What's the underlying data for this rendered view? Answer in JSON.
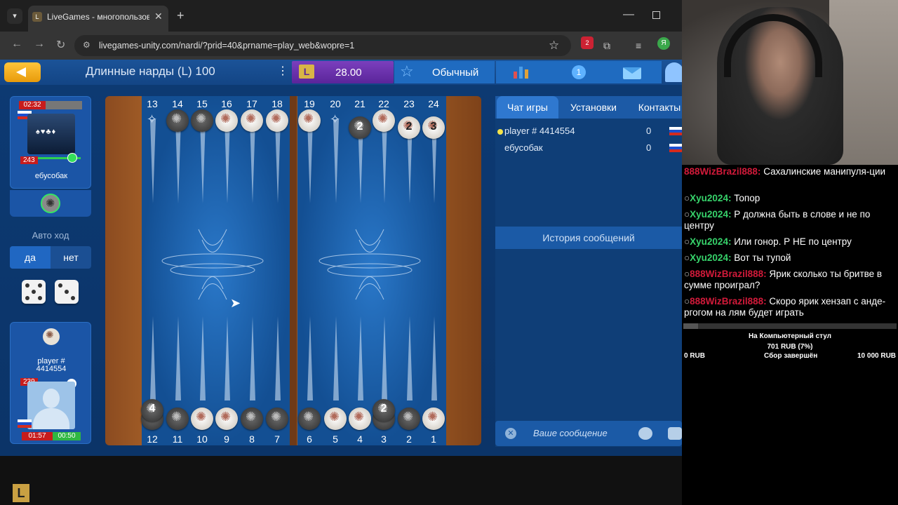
{
  "browser": {
    "tab_title": "LiveGames - многопользовате",
    "tab_favicon": "L",
    "url": "livegames-unity.com/nardi/?prid=40&prname=play_web&wopre=1",
    "ext_badge": "2",
    "profile_letter": "Я"
  },
  "topbar": {
    "title": "Длинные нарды (L) 100",
    "balance_icon": "L",
    "balance": "28.00",
    "mode": "Обычный",
    "info_count": "1"
  },
  "players": {
    "opponent": {
      "timer": "02:32",
      "rating": "243",
      "name": "ебусобак"
    },
    "auto_move_label": "Авто ход",
    "auto_yes": "да",
    "auto_no": "нет",
    "me": {
      "name": "player #\n4414554",
      "rating": "239",
      "time_total": "01:57",
      "time_move": "00:50"
    }
  },
  "dice": [
    5,
    3
  ],
  "board": {
    "top_numbers": [
      "13",
      "14",
      "15",
      "16",
      "17",
      "18",
      "19",
      "20",
      "21",
      "22",
      "23",
      "24"
    ],
    "bottom_numbers": [
      "12",
      "11",
      "10",
      "9",
      "8",
      "7",
      "6",
      "5",
      "4",
      "3",
      "2",
      "1"
    ],
    "top_checkers": [
      {
        "point": "13",
        "color": "empty",
        "count": ""
      },
      {
        "point": "14",
        "color": "b",
        "count": ""
      },
      {
        "point": "15",
        "color": "b",
        "count": ""
      },
      {
        "point": "16",
        "color": "w",
        "count": ""
      },
      {
        "point": "17",
        "color": "w",
        "count": ""
      },
      {
        "point": "18",
        "color": "w",
        "count": ""
      },
      {
        "point": "19",
        "color": "w",
        "count": ""
      },
      {
        "point": "20",
        "color": "empty",
        "count": ""
      },
      {
        "point": "21",
        "color": "b",
        "count": "2"
      },
      {
        "point": "22",
        "color": "w",
        "count": ""
      },
      {
        "point": "23",
        "color": "w",
        "count": "2"
      },
      {
        "point": "24",
        "color": "w",
        "count": "3"
      }
    ],
    "bottom_checkers": [
      {
        "point": "12",
        "color": "b",
        "count": "4"
      },
      {
        "point": "11",
        "color": "b",
        "count": ""
      },
      {
        "point": "10",
        "color": "w",
        "count": ""
      },
      {
        "point": "9",
        "color": "w",
        "count": ""
      },
      {
        "point": "8",
        "color": "b",
        "count": ""
      },
      {
        "point": "7",
        "color": "b",
        "count": ""
      },
      {
        "point": "6",
        "color": "b",
        "count": ""
      },
      {
        "point": "5",
        "color": "w",
        "count": ""
      },
      {
        "point": "4",
        "color": "w",
        "count": ""
      },
      {
        "point": "3",
        "color": "b",
        "count": "2"
      },
      {
        "point": "2",
        "color": "b",
        "count": ""
      },
      {
        "point": "1",
        "color": "w",
        "count": ""
      }
    ]
  },
  "chat": {
    "tab_chat": "Чат игры",
    "tab_settings": "Установки",
    "tab_contacts": "Контакты",
    "players": [
      {
        "name": "player # 4414554",
        "score": "0"
      },
      {
        "name": "ебусобак",
        "score": "0"
      }
    ],
    "history": "История сообщений",
    "placeholder": "Ваше сообщение"
  },
  "stream_chat": [
    {
      "user": "888WizBrazil888:",
      "text": "Сахалинские манипуля-ции",
      "red": true
    },
    {
      "user": "Xyu2024:",
      "text": "Топор",
      "red": false
    },
    {
      "user": "Xyu2024:",
      "text": "Р должна быть в слове и не по центру",
      "red": false
    },
    {
      "user": "Xyu2024:",
      "text": "Или гонор. Р НЕ по центру",
      "red": false
    },
    {
      "user": "Xyu2024:",
      "text": "Вот ты тупой",
      "red": false
    },
    {
      "user": "888WizBrazil888:",
      "text": "Ярик сколько ты бритве в сумме проиграл?",
      "red": true
    },
    {
      "user": "888WizBrazil888:",
      "text": "Скоро ярик хензап с анде-ргогом на лям будет играть",
      "red": true
    }
  ],
  "donation": {
    "goal": "На Компьютерный стул",
    "raised": "701 RUB (7%)",
    "min": "0 RUB",
    "status": "Сбор завершён",
    "max": "10 000 RUB",
    "progress": 0.07
  },
  "colors": {
    "game_bg": "#0d3a73",
    "accent": "#1f6bc0",
    "balance_bg": "#6b30ad",
    "chat_user_green": "#37d36b",
    "chat_user_red": "#d21a3a"
  }
}
